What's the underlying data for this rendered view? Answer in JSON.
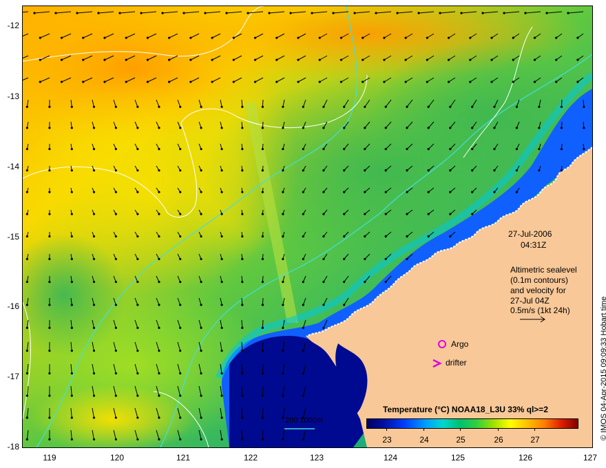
{
  "map": {
    "y_ticks": [
      "-12",
      "-13",
      "-14",
      "-15",
      "-16",
      "-17",
      "-18"
    ],
    "x_ticks": [
      "119",
      "120",
      "121",
      "122",
      "123",
      "124",
      "125",
      "126",
      "127"
    ],
    "lon_range": [
      118.6,
      127.0
    ],
    "lat_range": [
      -18.0,
      -11.7
    ]
  },
  "annotation": {
    "date": "27-Jul-2006",
    "time": "04:31Z",
    "alt_line1": "Altimetric sealevel",
    "alt_line2": "(0.1m contours)",
    "alt_line3": "and velocity for",
    "alt_line4": "27-Jul 04Z",
    "alt_line5": "0.5m/s (1kt 24h)"
  },
  "markers": {
    "argo_label": "Argo",
    "drifter_label": "drifter",
    "argo_color": "#e000e0",
    "drifter_color": "#e000e0"
  },
  "scale": {
    "label": "200  1000m"
  },
  "colorbar": {
    "title": "Temperature (°C) NOAA18_L3U 33% ql>=2",
    "ticks": [
      "23",
      "24",
      "25",
      "26",
      "27"
    ]
  },
  "credit": "© IMOS 04-Apr-2015 09:09:33 Hobart time",
  "colors": {
    "land": "#f8c898",
    "deep_water": "#000880",
    "cold_shelf": "#0070ff",
    "mid_water": "#30c060",
    "warm_water": "#f0d000",
    "hot_water": "#ff9000",
    "contour_iso": "#40e0e0",
    "contour_ssh": "#ffffff"
  }
}
